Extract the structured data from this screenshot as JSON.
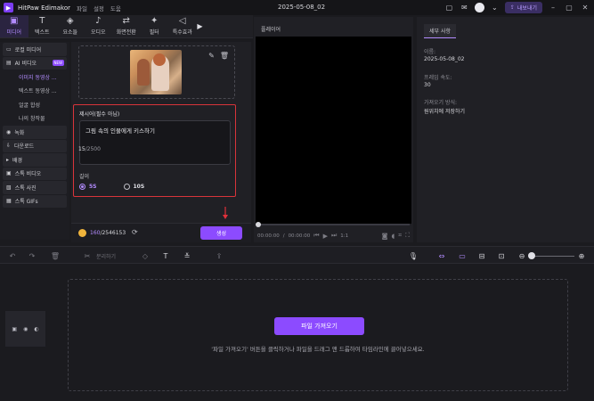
{
  "app": {
    "name": "HitPaw Edimakor",
    "menu": [
      "파일",
      "설정",
      "도움"
    ],
    "doc_title": "2025-05-08_02",
    "export_label": "내보내기",
    "export_icon": "upload-icon"
  },
  "media_tabs": [
    {
      "label": "미디어",
      "icon": "media-icon",
      "glyph": "▣"
    },
    {
      "label": "텍스트",
      "icon": "text-icon",
      "glyph": "T"
    },
    {
      "label": "요소들",
      "icon": "elements-icon",
      "glyph": "◈"
    },
    {
      "label": "오디오",
      "icon": "music-note-icon",
      "glyph": "♪"
    },
    {
      "label": "화면전환",
      "icon": "transition-icon",
      "glyph": "⇄"
    },
    {
      "label": "필터",
      "icon": "filter-sparkle-icon",
      "glyph": "✦"
    },
    {
      "label": "특수효과",
      "icon": "effects-icon",
      "glyph": "◁"
    }
  ],
  "sidebar": {
    "items": [
      {
        "label": "로컬 미디어",
        "icon": "folder-icon",
        "glyph": "▭",
        "kind": "group"
      },
      {
        "label": "AI 비디오",
        "icon": "ai-video-icon",
        "glyph": "▤",
        "kind": "group",
        "badge": "NEW"
      },
      {
        "label": "이미지 동영상 ...",
        "kind": "sub",
        "active": true
      },
      {
        "label": "텍스트 동영상 ...",
        "kind": "sub"
      },
      {
        "label": "얼굴 합성",
        "kind": "sub"
      },
      {
        "label": "나의 창작물",
        "kind": "sub"
      },
      {
        "label": "녹화",
        "icon": "record-icon",
        "glyph": "◉",
        "kind": "group"
      },
      {
        "label": "다운로드",
        "icon": "download-icon",
        "glyph": "⇩",
        "kind": "group"
      },
      {
        "label": "배경",
        "icon": "play-triangle-icon",
        "glyph": "▸",
        "kind": "group"
      },
      {
        "label": "스톡 비디오",
        "icon": "stock-video-icon",
        "glyph": "▣",
        "kind": "group"
      },
      {
        "label": "스톡 사진",
        "icon": "stock-photo-icon",
        "glyph": "▧",
        "kind": "group"
      },
      {
        "label": "스톡 GIFs",
        "icon": "gif-icon",
        "glyph": "▦",
        "kind": "group"
      }
    ]
  },
  "generator": {
    "description_label": "제시어(필수 아님)",
    "description_value": "그림 속의 인물에게 키스하기",
    "count_current": "15",
    "count_max": "/2500",
    "length_label": "길이",
    "options": [
      {
        "label": "5S",
        "selected": true
      },
      {
        "label": "10S",
        "selected": false
      }
    ],
    "credits_used": "160",
    "credits_total": "/2546153",
    "generate_label": "생성"
  },
  "player": {
    "title": "플레이어",
    "time_current": "00:00:00",
    "time_total": "00:00:00",
    "speed": "1:1"
  },
  "properties": {
    "tab_label": "세부 사항",
    "fields": [
      {
        "key": "이름:",
        "value": "2025-05-08_02"
      },
      {
        "key": "프레임 속도:",
        "value": "30"
      },
      {
        "key": "가져오기 방식:",
        "value": "원위치에 저장하기"
      }
    ]
  },
  "toolbar": {
    "split_label": "분리하기"
  },
  "timeline": {
    "import_label": "파일 가져오기",
    "hint": "'파일 가져오기' 버튼을 클릭하거나 파일을 드래그 앤 드롭하여 타임라인에 끌어넣으세요."
  },
  "colors": {
    "accent": "#8c4bff",
    "highlight_border": "#d8343a"
  }
}
